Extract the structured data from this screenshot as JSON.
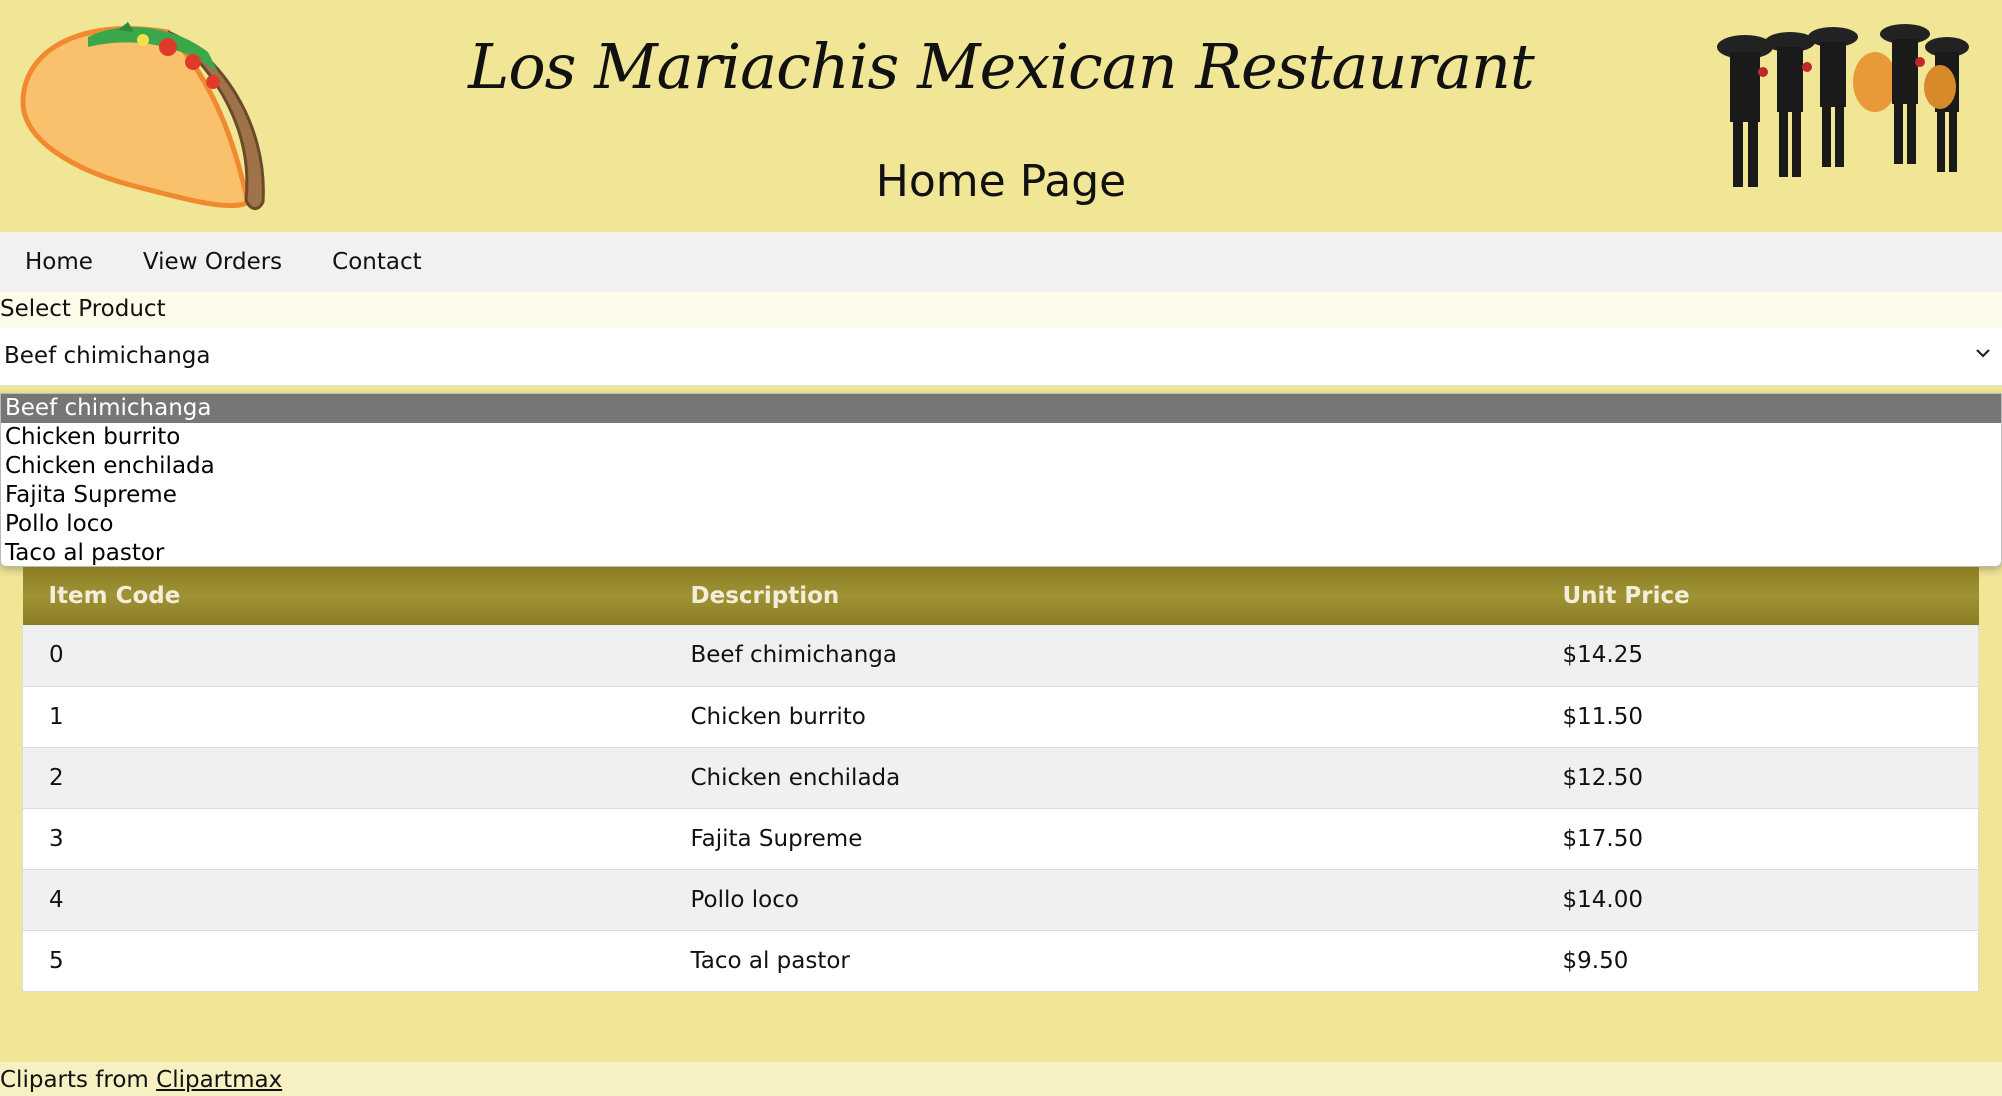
{
  "header": {
    "title": "Los Mariachis Mexican Restaurant",
    "subtitle": "Home Page",
    "left_image_icon": "taco-icon",
    "right_image_icon": "mariachi-band-icon"
  },
  "nav": {
    "items": [
      {
        "label": "Home"
      },
      {
        "label": "View Orders"
      },
      {
        "label": "Contact"
      }
    ]
  },
  "product_select": {
    "label": "Select Product",
    "selected": "Beef chimichanga",
    "options": [
      "Beef chimichanga",
      "Chicken burrito",
      "Chicken enchilada",
      "Fajita Supreme",
      "Pollo loco",
      "Taco al pastor"
    ]
  },
  "table": {
    "headers": [
      "Item Code",
      "Description",
      "Unit Price"
    ],
    "rows": [
      [
        "0",
        "Beef chimichanga",
        "$14.25"
      ],
      [
        "1",
        "Chicken burrito",
        "$11.50"
      ],
      [
        "2",
        "Chicken enchilada",
        "$12.50"
      ],
      [
        "3",
        "Fajita Supreme",
        "$17.50"
      ],
      [
        "4",
        "Pollo loco",
        "$14.00"
      ],
      [
        "5",
        "Taco al pastor",
        "$9.50"
      ]
    ]
  },
  "footer": {
    "text": "Cliparts from ",
    "link": "Clipartmax"
  },
  "colors": {
    "page_background": "#f0e696",
    "table_header": "#9a8c2e",
    "selected_option": "#767676"
  }
}
